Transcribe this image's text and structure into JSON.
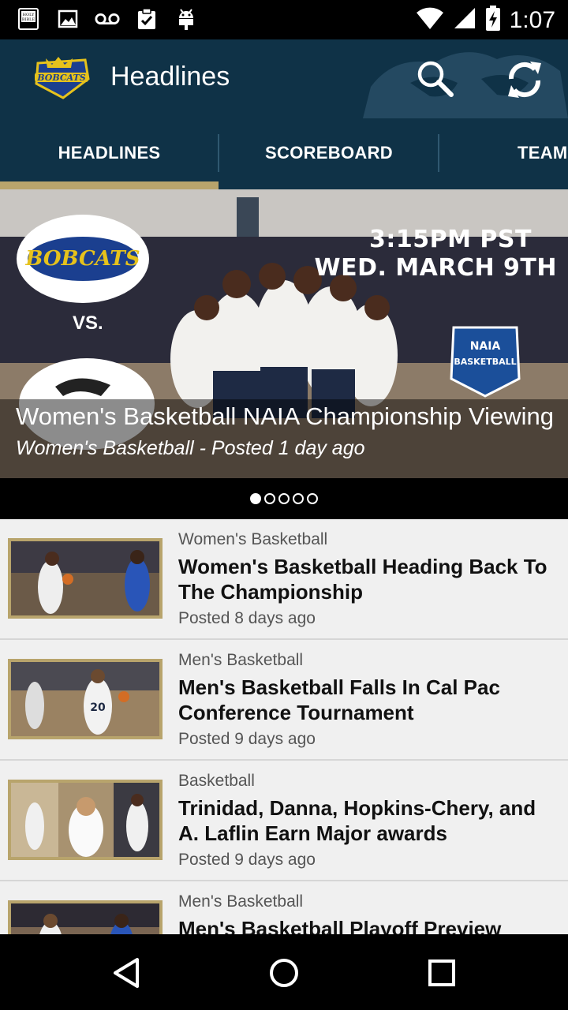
{
  "status_bar": {
    "time": "1:07",
    "icons": [
      "bible-app-icon",
      "image-icon",
      "voicemail-icon",
      "clipboard-check-icon",
      "android-icon",
      "wifi-icon",
      "signal-icon",
      "battery-icon"
    ]
  },
  "app_bar": {
    "title": "Headlines",
    "logo_name": "bobcats-logo",
    "actions": [
      "search-icon",
      "refresh-icon"
    ]
  },
  "tabs": [
    {
      "label": "HEADLINES",
      "active": true
    },
    {
      "label": "SCOREBOARD",
      "active": false
    },
    {
      "label": "TEAM",
      "active": false
    }
  ],
  "hero": {
    "title": "Women's Basketball NAIA Championship Viewing",
    "subtitle": "Women's Basketball - Posted 1 day ago",
    "image_text": {
      "time_line1": "3:15PM PST",
      "time_line2": "WED. MARCH 9TH",
      "vs": "VS."
    },
    "pager": {
      "count": 5,
      "active_index": 0
    }
  },
  "articles": [
    {
      "category": "Women's Basketball",
      "title": "Women's Basketball Heading Back To The Championship",
      "posted": "Posted 8 days ago"
    },
    {
      "category": "Men's Basketball",
      "title": "Men's Basketball Falls In Cal Pac Conference Tournament",
      "posted": "Posted 9 days ago"
    },
    {
      "category": "Basketball",
      "title": "Trinidad, Danna, Hopkins-Chery, and A. Laflin Earn Major awards",
      "posted": "Posted 9 days ago"
    },
    {
      "category": "Men's Basketball",
      "title": "Men's Basketball Playoff Preview",
      "posted": ""
    }
  ],
  "colors": {
    "header": "#0f3247",
    "accent": "#b8a46c",
    "list_bg": "#f0f0f0"
  },
  "nav_bar": [
    "back-icon",
    "home-icon",
    "recents-icon"
  ]
}
